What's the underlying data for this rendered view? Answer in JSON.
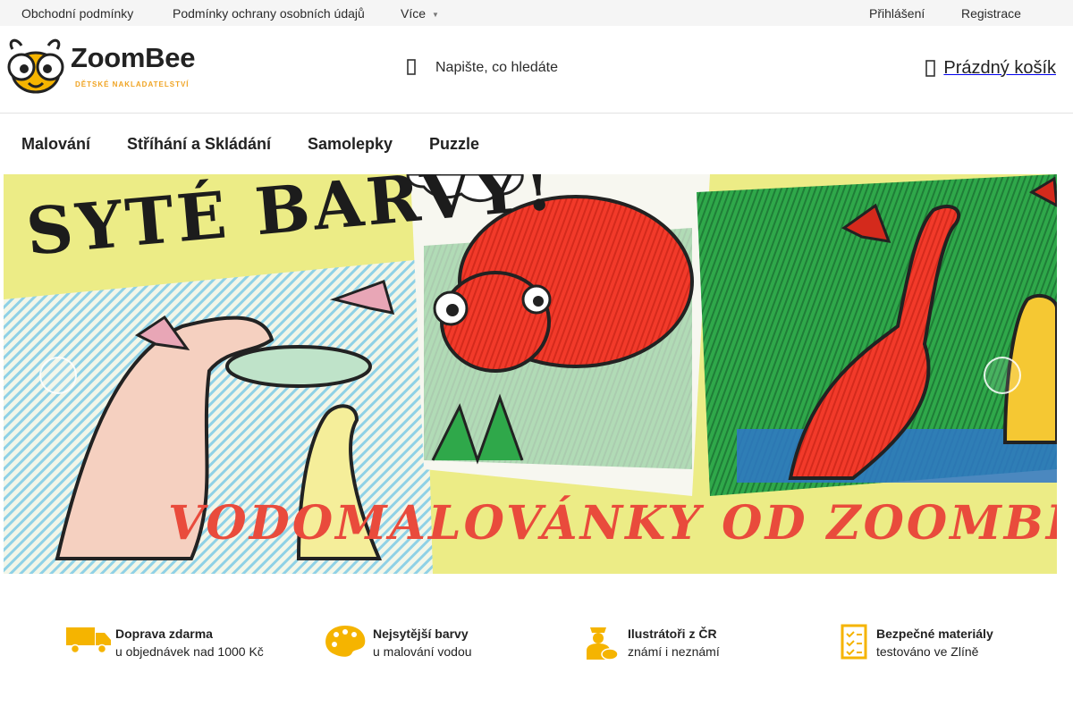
{
  "topbar": {
    "links": [
      "Obchodní podmínky",
      "Podmínky ochrany osobních údajů",
      "Více"
    ],
    "login": "Přihlášení",
    "register": "Registrace"
  },
  "header": {
    "logo_text": "ZoomBee",
    "logo_subtitle": "DĚTSKÉ NAKLADATELSTVÍ",
    "search_placeholder": "Napište, co hledáte",
    "cart_label": "Prázdný košík"
  },
  "categories": [
    "Malování",
    "Stříhání a Skládání",
    "Samolepky",
    "Puzzle"
  ],
  "banner": {
    "headline": "SYTÉ BARVY!",
    "footer": "VODOMALOVÁNKY OD ZOOMBEE!"
  },
  "benefits": [
    {
      "icon": "truck-icon",
      "title": "Doprava zdarma",
      "subtitle": "u objednávek nad 1000 Kč"
    },
    {
      "icon": "palette-icon",
      "title": "Nejsytější barvy",
      "subtitle": "u malování vodou"
    },
    {
      "icon": "illustrator-icon",
      "title": "Ilustrátoři z ČR",
      "subtitle": "známí i neznámí"
    },
    {
      "icon": "checklist-icon",
      "title": "Bezpečné materiály",
      "subtitle": "testováno ve Zlíně"
    }
  ],
  "colors": {
    "accent": "#f5b400",
    "banner_red": "#e94b3c",
    "banner_bg": "#ecec86"
  }
}
